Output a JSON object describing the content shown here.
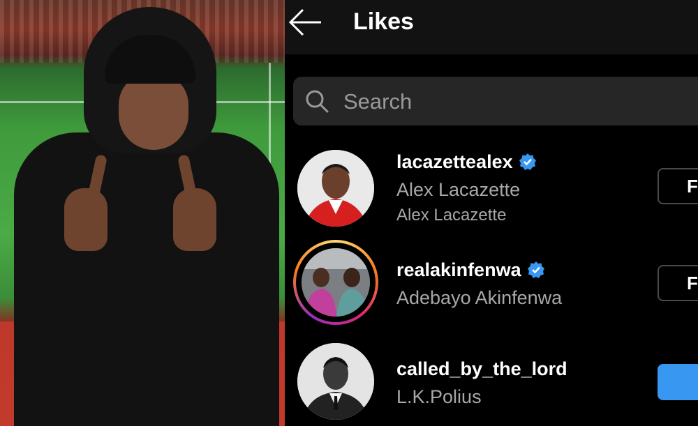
{
  "header": {
    "title": "Likes",
    "back_icon": "arrow-left-icon"
  },
  "search": {
    "placeholder": "Search",
    "icon": "search-icon"
  },
  "likes": [
    {
      "username": "lacazettealex",
      "full_name": "Alex Lacazette",
      "subtitle": "Alex Lacazette",
      "verified": true,
      "button_label": "F",
      "button_style": "outline"
    },
    {
      "username": "realakinfenwa",
      "full_name": "Adebayo Akinfenwa",
      "verified": true,
      "has_story": true,
      "button_label": "F",
      "button_style": "outline"
    },
    {
      "username": "called_by_the_lord",
      "full_name": "L.K.Polius",
      "verified": false,
      "button_label": "",
      "button_style": "primary"
    }
  ],
  "colors": {
    "background": "#000000",
    "topbar": "#121212",
    "search_bg": "#262626",
    "secondary_text": "#a8a8a8",
    "verified_blue": "#3897f0",
    "primary_button": "#3897f0"
  }
}
